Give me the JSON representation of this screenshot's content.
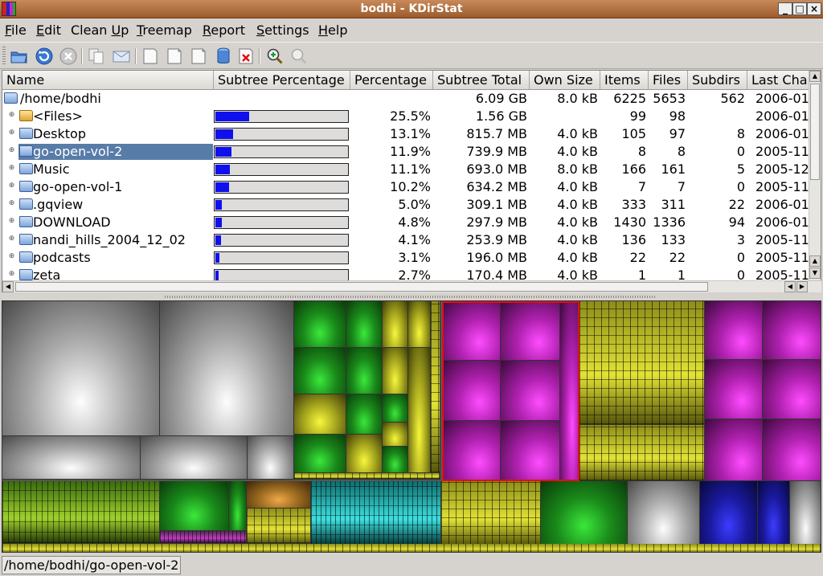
{
  "window": {
    "title": "bodhi - KDirStat",
    "btn_min": "_",
    "btn_max": "□",
    "btn_close": "×"
  },
  "menu": [
    {
      "acc": "F",
      "rest": "ile"
    },
    {
      "acc": "E",
      "rest": "dit"
    },
    {
      "pre": "Clean ",
      "acc": "U",
      "rest": "p"
    },
    {
      "acc": "T",
      "rest": "reemap"
    },
    {
      "acc": "R",
      "rest": "eport"
    },
    {
      "acc": "S",
      "rest": "ettings"
    },
    {
      "acc": "H",
      "rest": "elp"
    }
  ],
  "toolbar": {
    "icons": [
      "open-folder-icon",
      "refresh-icon",
      "stop-icon",
      "copy-icon",
      "mail-icon",
      "select-parent-icon",
      "page-icon",
      "page-alt-icon",
      "database-icon",
      "delete-icon",
      "zoom-in-icon",
      "zoom-out-icon"
    ]
  },
  "columns": [
    "Name",
    "Subtree Percentage",
    "Percentage",
    "Subtree Total",
    "Own Size",
    "Items",
    "Files",
    "Subdirs",
    "Last Change"
  ],
  "root": {
    "name": "/home/bodhi",
    "subtree_total": "6.09 GB",
    "own_size": "8.0 kB",
    "items": "6225",
    "files": "5653",
    "subdirs": "562",
    "last_change": "2006-01"
  },
  "rows": [
    {
      "name": "<Files>",
      "pct": "25.5%",
      "pct_value": 25.5,
      "total": "1.56 GB",
      "own": "",
      "items": "99",
      "files": "98",
      "subdirs": "",
      "last": "2006-01",
      "type": "files"
    },
    {
      "name": "Desktop",
      "pct": "13.1%",
      "pct_value": 13.1,
      "total": "815.7 MB",
      "own": "4.0 kB",
      "items": "105",
      "files": "97",
      "subdirs": "8",
      "last": "2006-01",
      "type": "dir"
    },
    {
      "name": "go-open-vol-2",
      "pct": "11.9%",
      "pct_value": 11.9,
      "total": "739.9 MB",
      "own": "4.0 kB",
      "items": "8",
      "files": "8",
      "subdirs": "0",
      "last": "2005-11",
      "type": "dir",
      "selected": true
    },
    {
      "name": "Music",
      "pct": "11.1%",
      "pct_value": 11.1,
      "total": "693.0 MB",
      "own": "8.0 kB",
      "items": "166",
      "files": "161",
      "subdirs": "5",
      "last": "2005-12",
      "type": "dir"
    },
    {
      "name": "go-open-vol-1",
      "pct": "10.2%",
      "pct_value": 10.2,
      "total": "634.2 MB",
      "own": "4.0 kB",
      "items": "7",
      "files": "7",
      "subdirs": "0",
      "last": "2005-11",
      "type": "dir"
    },
    {
      "name": ".gqview",
      "pct": "5.0%",
      "pct_value": 5.0,
      "total": "309.1 MB",
      "own": "4.0 kB",
      "items": "333",
      "files": "311",
      "subdirs": "22",
      "last": "2006-01",
      "type": "dir"
    },
    {
      "name": "DOWNLOAD",
      "pct": "4.8%",
      "pct_value": 4.8,
      "total": "297.9 MB",
      "own": "4.0 kB",
      "items": "1430",
      "files": "1336",
      "subdirs": "94",
      "last": "2006-01",
      "type": "dir"
    },
    {
      "name": "nandi_hills_2004_12_02",
      "pct": "4.1%",
      "pct_value": 4.1,
      "total": "253.9 MB",
      "own": "4.0 kB",
      "items": "136",
      "files": "133",
      "subdirs": "3",
      "last": "2005-11",
      "type": "dir"
    },
    {
      "name": "podcasts",
      "pct": "3.1%",
      "pct_value": 3.1,
      "total": "196.0 MB",
      "own": "4.0 kB",
      "items": "22",
      "files": "22",
      "subdirs": "0",
      "last": "2005-11",
      "type": "dir"
    },
    {
      "name": "zeta",
      "pct": "2.7%",
      "pct_value": 2.7,
      "total": "170.4 MB",
      "own": "4.0 kB",
      "items": "1",
      "files": "1",
      "subdirs": "0",
      "last": "2005-11",
      "type": "dir"
    }
  ],
  "status": {
    "path": "/home/bodhi/go-open-vol-2"
  },
  "colors": {
    "selection": "#587ca8",
    "bar_fill": "#1010ee",
    "title_bar": "#b06d3c",
    "treemap_highlight": "#e01010"
  }
}
